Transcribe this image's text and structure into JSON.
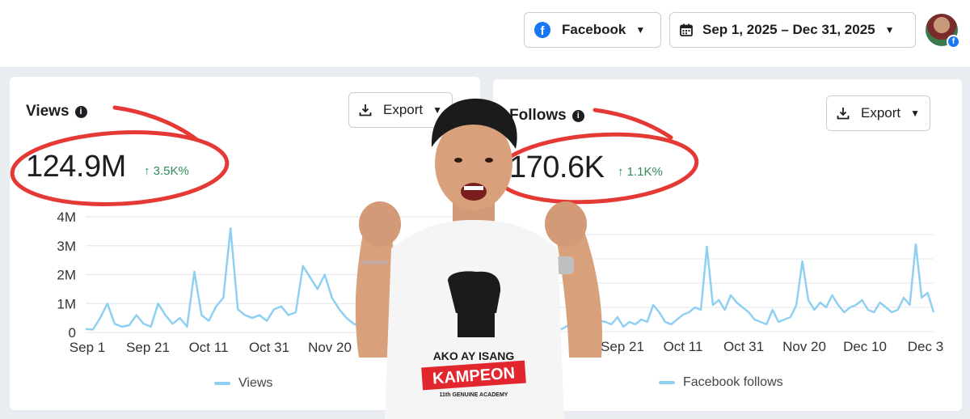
{
  "topbar": {
    "platform_label": "Facebook",
    "date_range_label": "Sep 1, 2025 – Dec 31, 2025"
  },
  "views": {
    "title": "Views",
    "export_label": "Export",
    "total": "124.9M",
    "delta": "3.5K%",
    "legend": "Views"
  },
  "follows": {
    "title": "Follows",
    "export_label": "Export",
    "total": "170.6K",
    "delta": "1.1K%",
    "legend": "Facebook follows"
  },
  "shirt": {
    "line1": "AKO AY ISANG",
    "line2": "KAMPEON",
    "line3": "11th GENUINE ACADEMY"
  },
  "colors": {
    "line": "#8fd0f2",
    "annotation": "#e53935",
    "positive": "#2e8b57",
    "brand": "#1877f2"
  },
  "chart_data": [
    {
      "type": "line",
      "series": [
        {
          "name": "Views",
          "values": [
            0.12,
            0.1,
            0.5,
            1.0,
            0.3,
            0.2,
            0.25,
            0.6,
            0.3,
            0.2,
            1.0,
            0.6,
            0.3,
            0.5,
            0.2,
            2.1,
            0.6,
            0.4,
            0.9,
            1.2,
            3.6,
            0.8,
            0.6,
            0.5,
            0.6,
            0.4,
            0.8,
            0.9,
            0.6,
            0.7,
            2.3,
            1.9,
            1.5,
            2.0,
            1.2,
            0.8,
            0.5,
            0.3,
            0.2,
            0.3,
            0.4,
            0.3,
            0.5,
            1.0,
            1.2,
            2.4,
            1.8,
            1.4,
            0.6,
            1.5,
            2.9,
            1.6,
            1.8
          ]
        }
      ],
      "x_tick_labels": [
        "Sep 1",
        "Sep 21",
        "Oct 11",
        "Oct 31",
        "Nov 20",
        "Dec 10"
      ],
      "y_tick_labels": [
        "0",
        "1M",
        "2M",
        "3M",
        "4M"
      ],
      "ylim": [
        0,
        4
      ]
    },
    {
      "type": "line",
      "series": [
        {
          "name": "Facebook follows",
          "values": [
            0.05,
            0.15,
            0.3,
            0.4,
            0.2,
            0.35,
            0.2,
            0.45,
            0.4,
            0.3,
            0.6,
            0.2,
            0.4,
            0.3,
            0.5,
            0.4,
            1.1,
            0.8,
            0.4,
            0.3,
            0.5,
            0.7,
            0.8,
            1.0,
            0.9,
            3.5,
            1.1,
            1.3,
            0.9,
            1.5,
            1.2,
            1.0,
            0.8,
            0.5,
            0.4,
            0.3,
            0.9,
            0.4,
            0.5,
            0.6,
            1.1,
            2.9,
            1.3,
            0.9,
            1.2,
            1.0,
            1.5,
            1.1,
            0.8,
            1.0,
            1.1,
            1.3,
            0.9,
            0.8,
            1.2,
            1.0,
            0.8,
            0.9,
            1.4,
            1.1,
            3.6,
            1.4,
            1.6,
            0.8
          ]
        }
      ],
      "x_tick_labels": [
        "Sep 21",
        "Oct 11",
        "Oct 31",
        "Nov 20",
        "Dec 10",
        "Dec 3"
      ],
      "ylim": [
        0,
        4
      ]
    }
  ]
}
